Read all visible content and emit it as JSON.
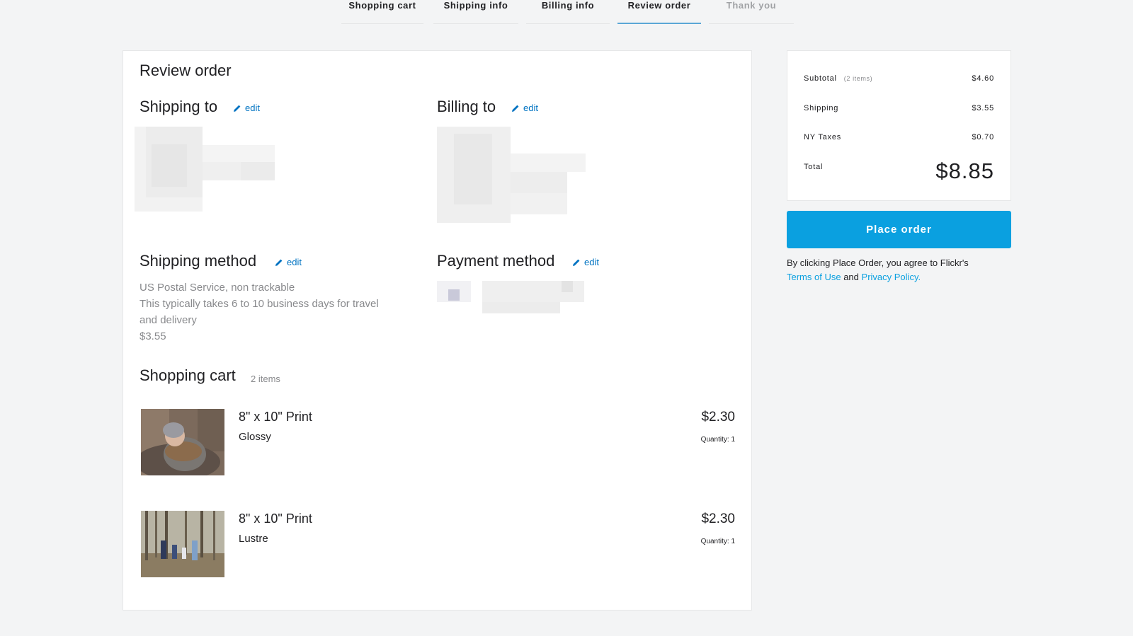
{
  "steps": [
    {
      "label": "Shopping cart",
      "state": "done"
    },
    {
      "label": "Shipping info",
      "state": "done"
    },
    {
      "label": "Billing info",
      "state": "done"
    },
    {
      "label": "Review order",
      "state": "active"
    },
    {
      "label": "Thank you",
      "state": "disabled"
    }
  ],
  "review": {
    "title": "Review order",
    "edit_label": "edit",
    "shipping_to": {
      "title": "Shipping to"
    },
    "billing_to": {
      "title": "Billing to"
    },
    "shipping_method": {
      "title": "Shipping method",
      "carrier": "US Postal Service, non trackable",
      "description": "This typically takes 6 to 10 business days for travel and delivery",
      "price": "$3.55"
    },
    "payment_method": {
      "title": "Payment method"
    }
  },
  "cart": {
    "title": "Shopping cart",
    "count_label": "2 items",
    "items": [
      {
        "name": "8\" x 10\" Print",
        "finish": "Glossy",
        "price": "$2.30",
        "quantity": "Quantity: 1",
        "thumb_icon": "newborn-photo"
      },
      {
        "name": "8\" x 10\" Print",
        "finish": "Lustre",
        "price": "$2.30",
        "quantity": "Quantity: 1",
        "thumb_icon": "family-forest-photo"
      }
    ]
  },
  "summary": {
    "subtotal_label": "Subtotal",
    "subtotal_note": "(2 items)",
    "subtotal_value": "$4.60",
    "shipping_label": "Shipping",
    "shipping_value": "$3.55",
    "taxes_label": "NY Taxes",
    "taxes_value": "$0.70",
    "total_label": "Total",
    "total_value": "$8.85"
  },
  "actions": {
    "place_order": "Place order",
    "legal_prefix": "By clicking Place Order, you agree to Flickr's",
    "terms_link": "Terms of Use",
    "legal_and": "and",
    "privacy_link": "Privacy Policy."
  },
  "colors": {
    "accent": "#0aa0e0",
    "link": "#0073c2",
    "active_step_underline": "#5aa7d6",
    "background": "#f3f4f5"
  }
}
